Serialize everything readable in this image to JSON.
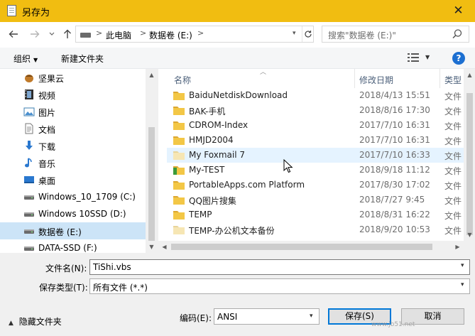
{
  "window": {
    "title": "另存为",
    "close_glyph": "✕"
  },
  "address": {
    "breadcrumbs": [
      "此电脑",
      "数据卷 (E:)"
    ],
    "search_placeholder": "搜索\"数据卷 (E:)\""
  },
  "toolbar": {
    "organize_label": "组织",
    "new_folder_label": "新建文件夹",
    "help_label": "?"
  },
  "nav": {
    "items": [
      {
        "label": "坚果云",
        "icon": "nut-icon"
      },
      {
        "label": "视频",
        "icon": "video-icon"
      },
      {
        "label": "图片",
        "icon": "picture-icon"
      },
      {
        "label": "文档",
        "icon": "document-icon"
      },
      {
        "label": "下载",
        "icon": "download-icon"
      },
      {
        "label": "音乐",
        "icon": "music-icon"
      },
      {
        "label": "桌面",
        "icon": "desktop-icon"
      },
      {
        "label": "Windows_10_1709 (C:)",
        "icon": "drive-icon"
      },
      {
        "label": "Windows 10SSD (D:)",
        "icon": "drive-icon"
      },
      {
        "label": "数据卷 (E:)",
        "icon": "drive-icon",
        "selected": true
      },
      {
        "label": "DATA-SSD (F:)",
        "icon": "drive-icon"
      }
    ]
  },
  "files": {
    "columns": {
      "name": "名称",
      "date": "修改日期",
      "type": "类型"
    },
    "rows": [
      {
        "name": "BaiduNetdiskDownload",
        "date": "2018/4/13 15:51",
        "type": "文件",
        "kind": "folder"
      },
      {
        "name": "BAK-手机",
        "date": "2018/8/16 17:30",
        "type": "文件",
        "kind": "folder"
      },
      {
        "name": "CDROM-Index",
        "date": "2017/7/10 16:31",
        "type": "文件",
        "kind": "folder"
      },
      {
        "name": "HMJD2004",
        "date": "2017/7/10 16:31",
        "type": "文件",
        "kind": "folder"
      },
      {
        "name": "My Foxmail 7",
        "date": "2017/7/10 16:33",
        "type": "文件",
        "kind": "folder-light",
        "hover": true
      },
      {
        "name": "My-TEST",
        "date": "2018/9/18 11:12",
        "type": "文件",
        "kind": "folder-green"
      },
      {
        "name": "PortableApps.com Platform",
        "date": "2017/8/30 17:02",
        "type": "文件",
        "kind": "folder"
      },
      {
        "name": "QQ图片搜集",
        "date": "2018/7/27 9:45",
        "type": "文件",
        "kind": "folder"
      },
      {
        "name": "TEMP",
        "date": "2018/8/31 16:22",
        "type": "文件",
        "kind": "folder"
      },
      {
        "name": "TEMP-办公机文本备份",
        "date": "2018/9/20 10:53",
        "type": "文件",
        "kind": "folder-light"
      }
    ]
  },
  "form": {
    "filename_label": "文件名(N):",
    "filename_value": "TiShi.vbs",
    "filetype_label": "保存类型(T):",
    "filetype_value": "所有文件  (*.*)",
    "hide_folders_label": "隐藏文件夹",
    "encoding_label": "编码(E):",
    "encoding_value": "ANSI",
    "save_label": "保存(S)",
    "cancel_label": "取消"
  },
  "watermark": "www.jb51.net",
  "colors": {
    "titlebar": "#f1bd11",
    "folder": "#f3c746",
    "selection": "#cce4f7",
    "accent": "#0078d7"
  }
}
